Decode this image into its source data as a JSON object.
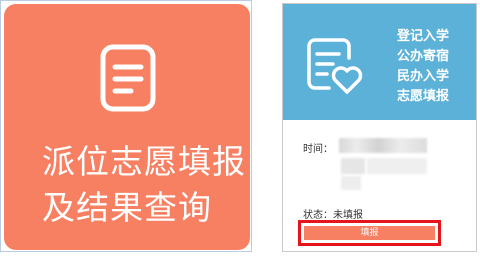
{
  "left_tile": {
    "icon": "document-icon",
    "title_line1": "派位志愿填报",
    "title_line2": "及结果查询",
    "background": "#f77f62"
  },
  "right_card": {
    "header_icon": "heart-list-icon",
    "header_lines": [
      "登记入学",
      "公办寄宿",
      "民办入学",
      "志愿填报"
    ],
    "header_background": "#5cb1d9",
    "time_label": "时间：",
    "status_text": "状态：未填报",
    "fill_button_label": "填报",
    "button_color": "#f77f62",
    "highlight_color": "#e8141b"
  }
}
